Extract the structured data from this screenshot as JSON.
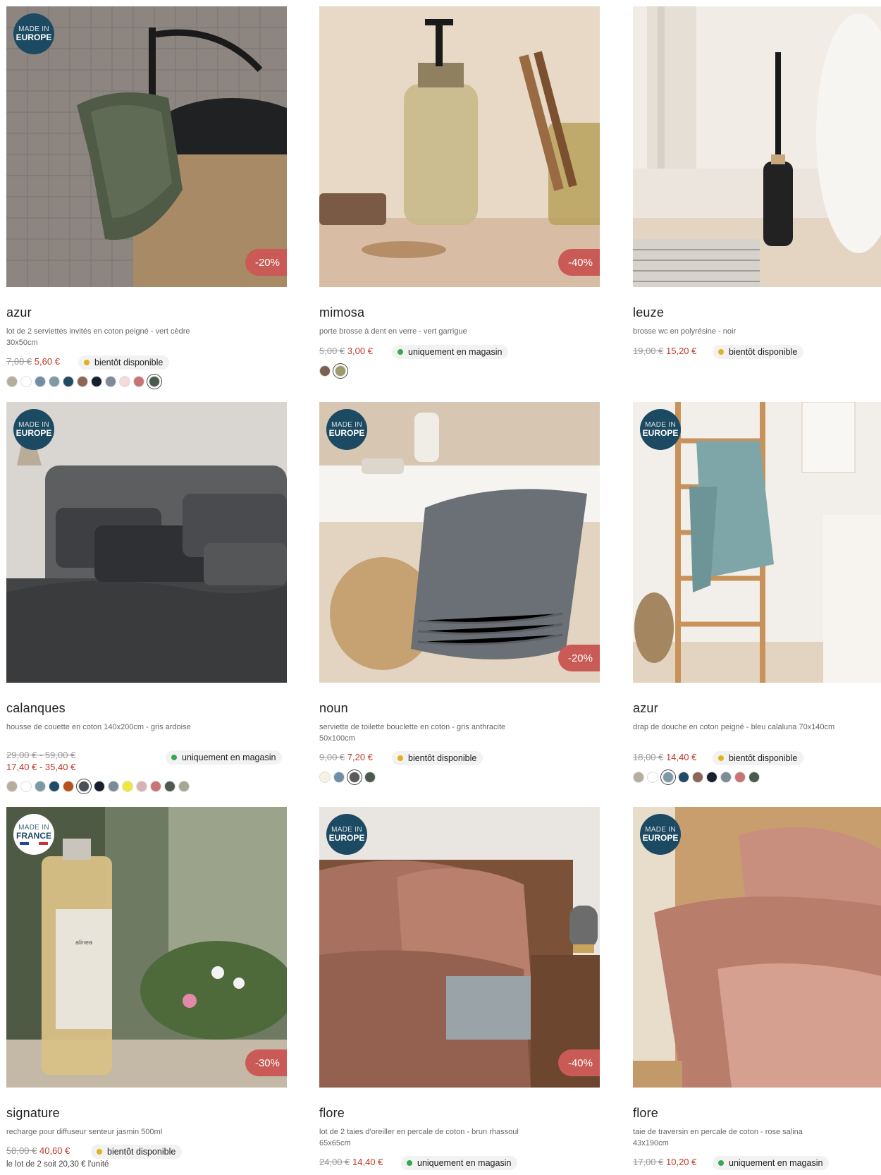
{
  "products": [
    {
      "name": "azur",
      "desc": "lot de 2 serviettes invités en coton peigné - vert cèdre 30x50cm",
      "old_price": "7,00 €",
      "new_price": "5,60 €",
      "status": "bientôt disponible",
      "status_color": "#e0b21c",
      "discount": "-20%",
      "made_in": {
        "line1": "MADE IN",
        "line2": "EUROPE"
      },
      "swatches": [
        "#b7ad9c",
        "#ffffff",
        "#6f8fa8",
        "#7b9aa6",
        "#1f4b66",
        "#8b6657",
        "#17202e",
        "#7d8b96",
        "#f4dada",
        "#c97474",
        "#4a5a4c"
      ],
      "selected_swatch": 10
    },
    {
      "name": "mimosa",
      "desc": "porte brosse à dent en verre - vert garrigue",
      "old_price": "5,00 €",
      "new_price": "3,00 €",
      "status": "uniquement en magasin",
      "status_color": "#34a853",
      "discount": "-40%",
      "made_in": null,
      "swatches": [
        "#7a6050",
        "#9a9a6a"
      ],
      "selected_swatch": 1
    },
    {
      "name": "leuze",
      "desc": "brosse wc en polyrésine - noir",
      "old_price": "19,00 €",
      "new_price": "15,20 €",
      "status": "bientôt disponible",
      "status_color": "#e0b21c",
      "discount": "",
      "made_in": null,
      "swatches": [],
      "selected_swatch": -1
    },
    {
      "name": "calanques",
      "desc": "housse de couette en coton 140x200cm - gris ardoise",
      "old_price": "29,00 € - 59,00 €",
      "new_price": "17,40 € - 35,40 €",
      "status": "uniquement en magasin",
      "status_color": "#34a853",
      "discount": "",
      "made_in": {
        "line1": "MADE IN",
        "line2": "EUROPE"
      },
      "swatches": [
        "#b7ad9c",
        "#ffffff",
        "#7b9aa6",
        "#1f4b66",
        "#b5531c",
        "#4b4f57",
        "#17202e",
        "#7d8b96",
        "#f0e63c",
        "#d9b3b3",
        "#c97474",
        "#4a5a4c",
        "#a3a893"
      ],
      "selected_swatch": 5
    },
    {
      "name": "noun",
      "desc": "serviette de toilette bouclette en coton - gris anthracite 50x100cm",
      "old_price": "9,00 €",
      "new_price": "7,20 €",
      "status": "bientôt disponible",
      "status_color": "#e0b21c",
      "discount": "-20%",
      "made_in": {
        "line1": "MADE IN",
        "line2": "EUROPE"
      },
      "swatches": [
        "#f6f3e6",
        "#6f8fa8",
        "#5a5a5a",
        "#4a5a4c"
      ],
      "selected_swatch": 2
    },
    {
      "name": "azur",
      "desc": "drap de douche en coton peigné - bleu calaluna 70x140cm",
      "old_price": "18,00 €",
      "new_price": "14,40 €",
      "status": "bientôt disponible",
      "status_color": "#e0b21c",
      "discount": "",
      "made_in": {
        "line1": "MADE IN",
        "line2": "EUROPE"
      },
      "swatches": [
        "#b7ad9c",
        "#ffffff",
        "#7b9aa6",
        "#1f4b66",
        "#8b6657",
        "#17202e",
        "#7d8b96",
        "#c97474",
        "#4a5a4c"
      ],
      "selected_swatch": 2
    },
    {
      "name": "signature",
      "desc": "recharge pour diffuseur senteur jasmin 500ml",
      "old_price": "58,00 €",
      "new_price": "40,60 €",
      "status": "bientôt disponible",
      "status_color": "#e0b21c",
      "discount": "-30%",
      "made_in": {
        "line1": "MADE IN",
        "line2": "FRANCE"
      },
      "unit_note": "le lot de 2 soit 20,30 € l'unité",
      "swatches": [],
      "selected_swatch": -1
    },
    {
      "name": "flore",
      "desc": "lot de 2 taies d'oreiller en percale de coton - brun rhassoul 65x65cm",
      "old_price": "24,00 €",
      "new_price": "14,40 €",
      "status": "uniquement en magasin",
      "status_color": "#34a853",
      "discount": "-40%",
      "made_in": {
        "line1": "MADE IN",
        "line2": "EUROPE"
      },
      "swatches": [],
      "selected_swatch": -1
    },
    {
      "name": "flore",
      "desc": "taie de traversin en percale de coton - rose salina 43x190cm",
      "old_price": "17,00 €",
      "new_price": "10,20 €",
      "status": "uniquement en magasin",
      "status_color": "#34a853",
      "discount": "",
      "made_in": {
        "line1": "MADE IN",
        "line2": "EUROPE"
      },
      "swatches": [],
      "selected_swatch": -1
    }
  ]
}
